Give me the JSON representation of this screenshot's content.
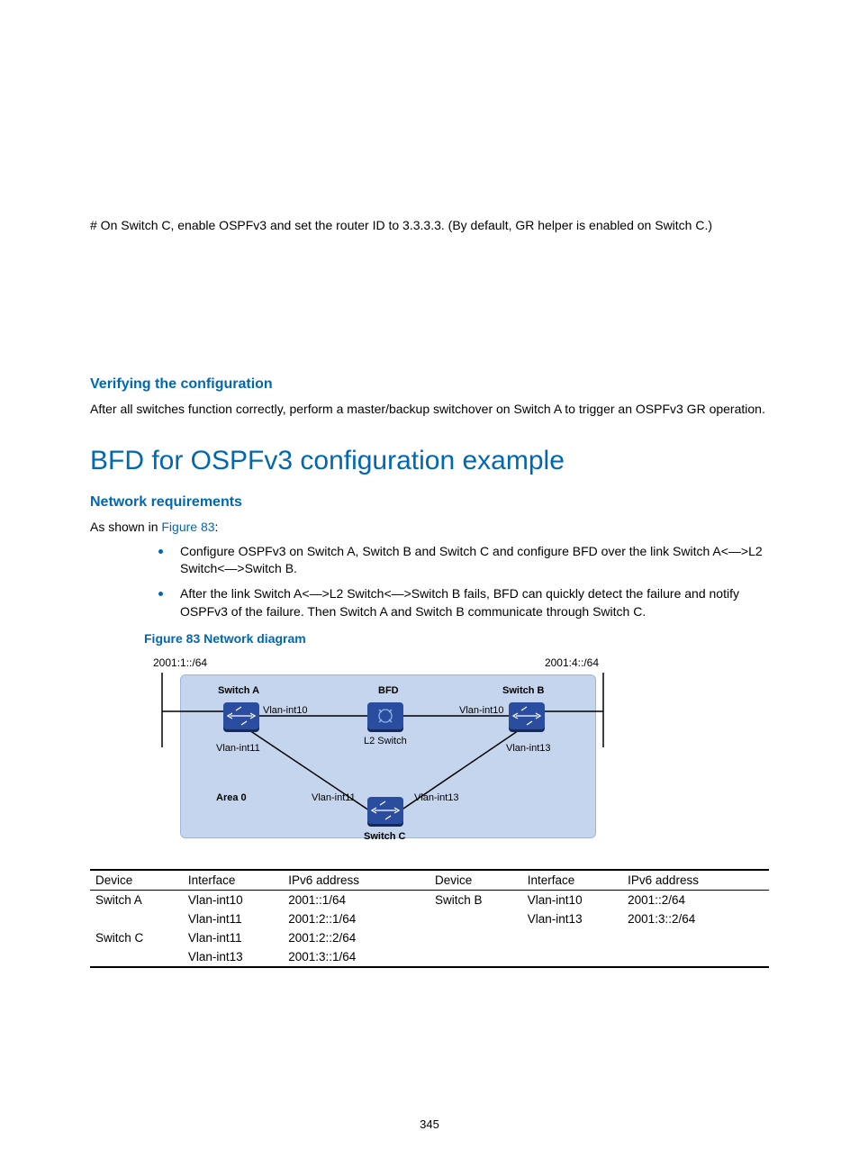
{
  "intro": {
    "paragraph": "# On Switch C, enable OSPFv3 and set the router ID to 3.3.3.3. (By default, GR helper is enabled on Switch C.)"
  },
  "verifying": {
    "heading": "Verifying the configuration",
    "paragraph": "After all switches function correctly, perform a master/backup switchover on Switch A to trigger an OSPFv3 GR operation."
  },
  "bfd": {
    "heading": "BFD for OSPFv3 configuration example"
  },
  "netreq": {
    "heading": "Network requirements",
    "intro_prefix": "As shown in ",
    "intro_link": "Figure 83",
    "intro_suffix": ":",
    "bullets": [
      "Configure OSPFv3 on Switch A, Switch B and Switch C and configure BFD over the link Switch A<—>L2 Switch<—>Switch B.",
      "After the link Switch A<—>L2 Switch<—>Switch B fails, BFD can quickly detect the failure and notify OSPFv3 of the failure. Then Switch A and Switch B communicate through Switch C."
    ]
  },
  "figure": {
    "caption": "Figure 83 Network diagram",
    "labels": {
      "net_left": "2001:1::/64",
      "net_right": "2001:4::/64",
      "switch_a": "Switch A",
      "switch_b": "Switch B",
      "switch_c": "Switch C",
      "l2_switch": "L2 Switch",
      "bfd": "BFD",
      "area0": "Area 0",
      "vlan10_a": "Vlan-int10",
      "vlan10_b": "Vlan-int10",
      "vlan11_a": "Vlan-int11",
      "vlan11_c": "Vlan-int11",
      "vlan13_b": "Vlan-int13",
      "vlan13_c": "Vlan-int13"
    }
  },
  "table": {
    "headers": [
      "Device",
      "Interface",
      "IPv6 address",
      "Device",
      "Interface",
      "IPv6 address"
    ],
    "rows": [
      [
        "Switch A",
        "Vlan-int10",
        "2001::1/64",
        "Switch B",
        "Vlan-int10",
        "2001::2/64"
      ],
      [
        "",
        "Vlan-int11",
        "2001:2::1/64",
        "",
        "Vlan-int13",
        "2001:3::2/64"
      ],
      [
        "Switch C",
        "Vlan-int11",
        "2001:2::2/64",
        "",
        "",
        ""
      ],
      [
        "",
        "Vlan-int13",
        "2001:3::1/64",
        "",
        "",
        ""
      ]
    ]
  },
  "page_number": "345"
}
